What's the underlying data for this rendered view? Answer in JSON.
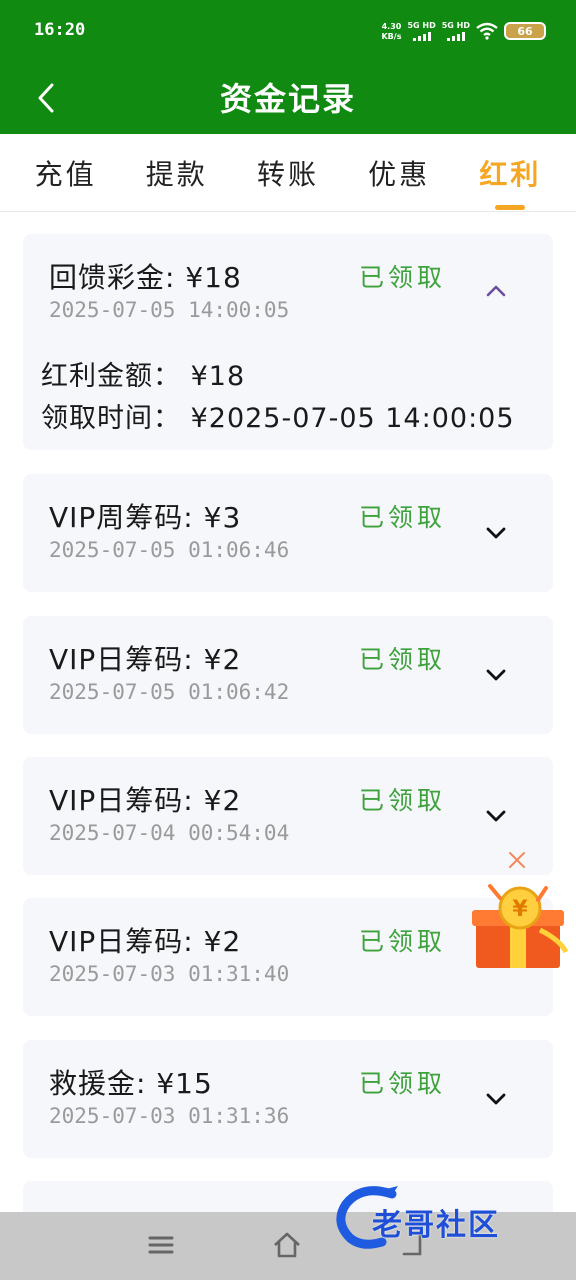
{
  "status_bar": {
    "time": "16:20",
    "net_speed_value": "4.30",
    "net_speed_unit": "KB/s",
    "sim1_label": "5G HD",
    "sim2_label": "5G HD",
    "battery": "66"
  },
  "header": {
    "title": "资金记录"
  },
  "tabs": [
    {
      "label": "充值",
      "active": false
    },
    {
      "label": "提款",
      "active": false
    },
    {
      "label": "转账",
      "active": false
    },
    {
      "label": "优惠",
      "active": false
    },
    {
      "label": "红利",
      "active": true
    }
  ],
  "records": [
    {
      "title": "回馈彩金: ¥18",
      "date": "2025-07-05 14:00:05",
      "status": "已领取",
      "expanded": true,
      "details": [
        "红利金额： ¥18",
        "领取时间： ¥2025-07-05 14:00:05"
      ]
    },
    {
      "title": "VIP周筹码: ¥3",
      "date": "2025-07-05 01:06:46",
      "status": "已领取",
      "expanded": false
    },
    {
      "title": "VIP日筹码: ¥2",
      "date": "2025-07-05 01:06:42",
      "status": "已领取",
      "expanded": false
    },
    {
      "title": "VIP日筹码: ¥2",
      "date": "2025-07-04 00:54:04",
      "status": "已领取",
      "expanded": false
    },
    {
      "title": "VIP日筹码: ¥2",
      "date": "2025-07-03 01:31:40",
      "status": "已领取",
      "expanded": false
    },
    {
      "title": "救援金: ¥15",
      "date": "2025-07-03 01:31:36",
      "status": "已领取",
      "expanded": false
    }
  ],
  "watermark": {
    "text": "老哥社区"
  },
  "colors": {
    "header_green": "#118a12",
    "accent_orange": "#f5a623",
    "status_green": "#3ea23c",
    "card_bg": "#f6f7fb"
  }
}
